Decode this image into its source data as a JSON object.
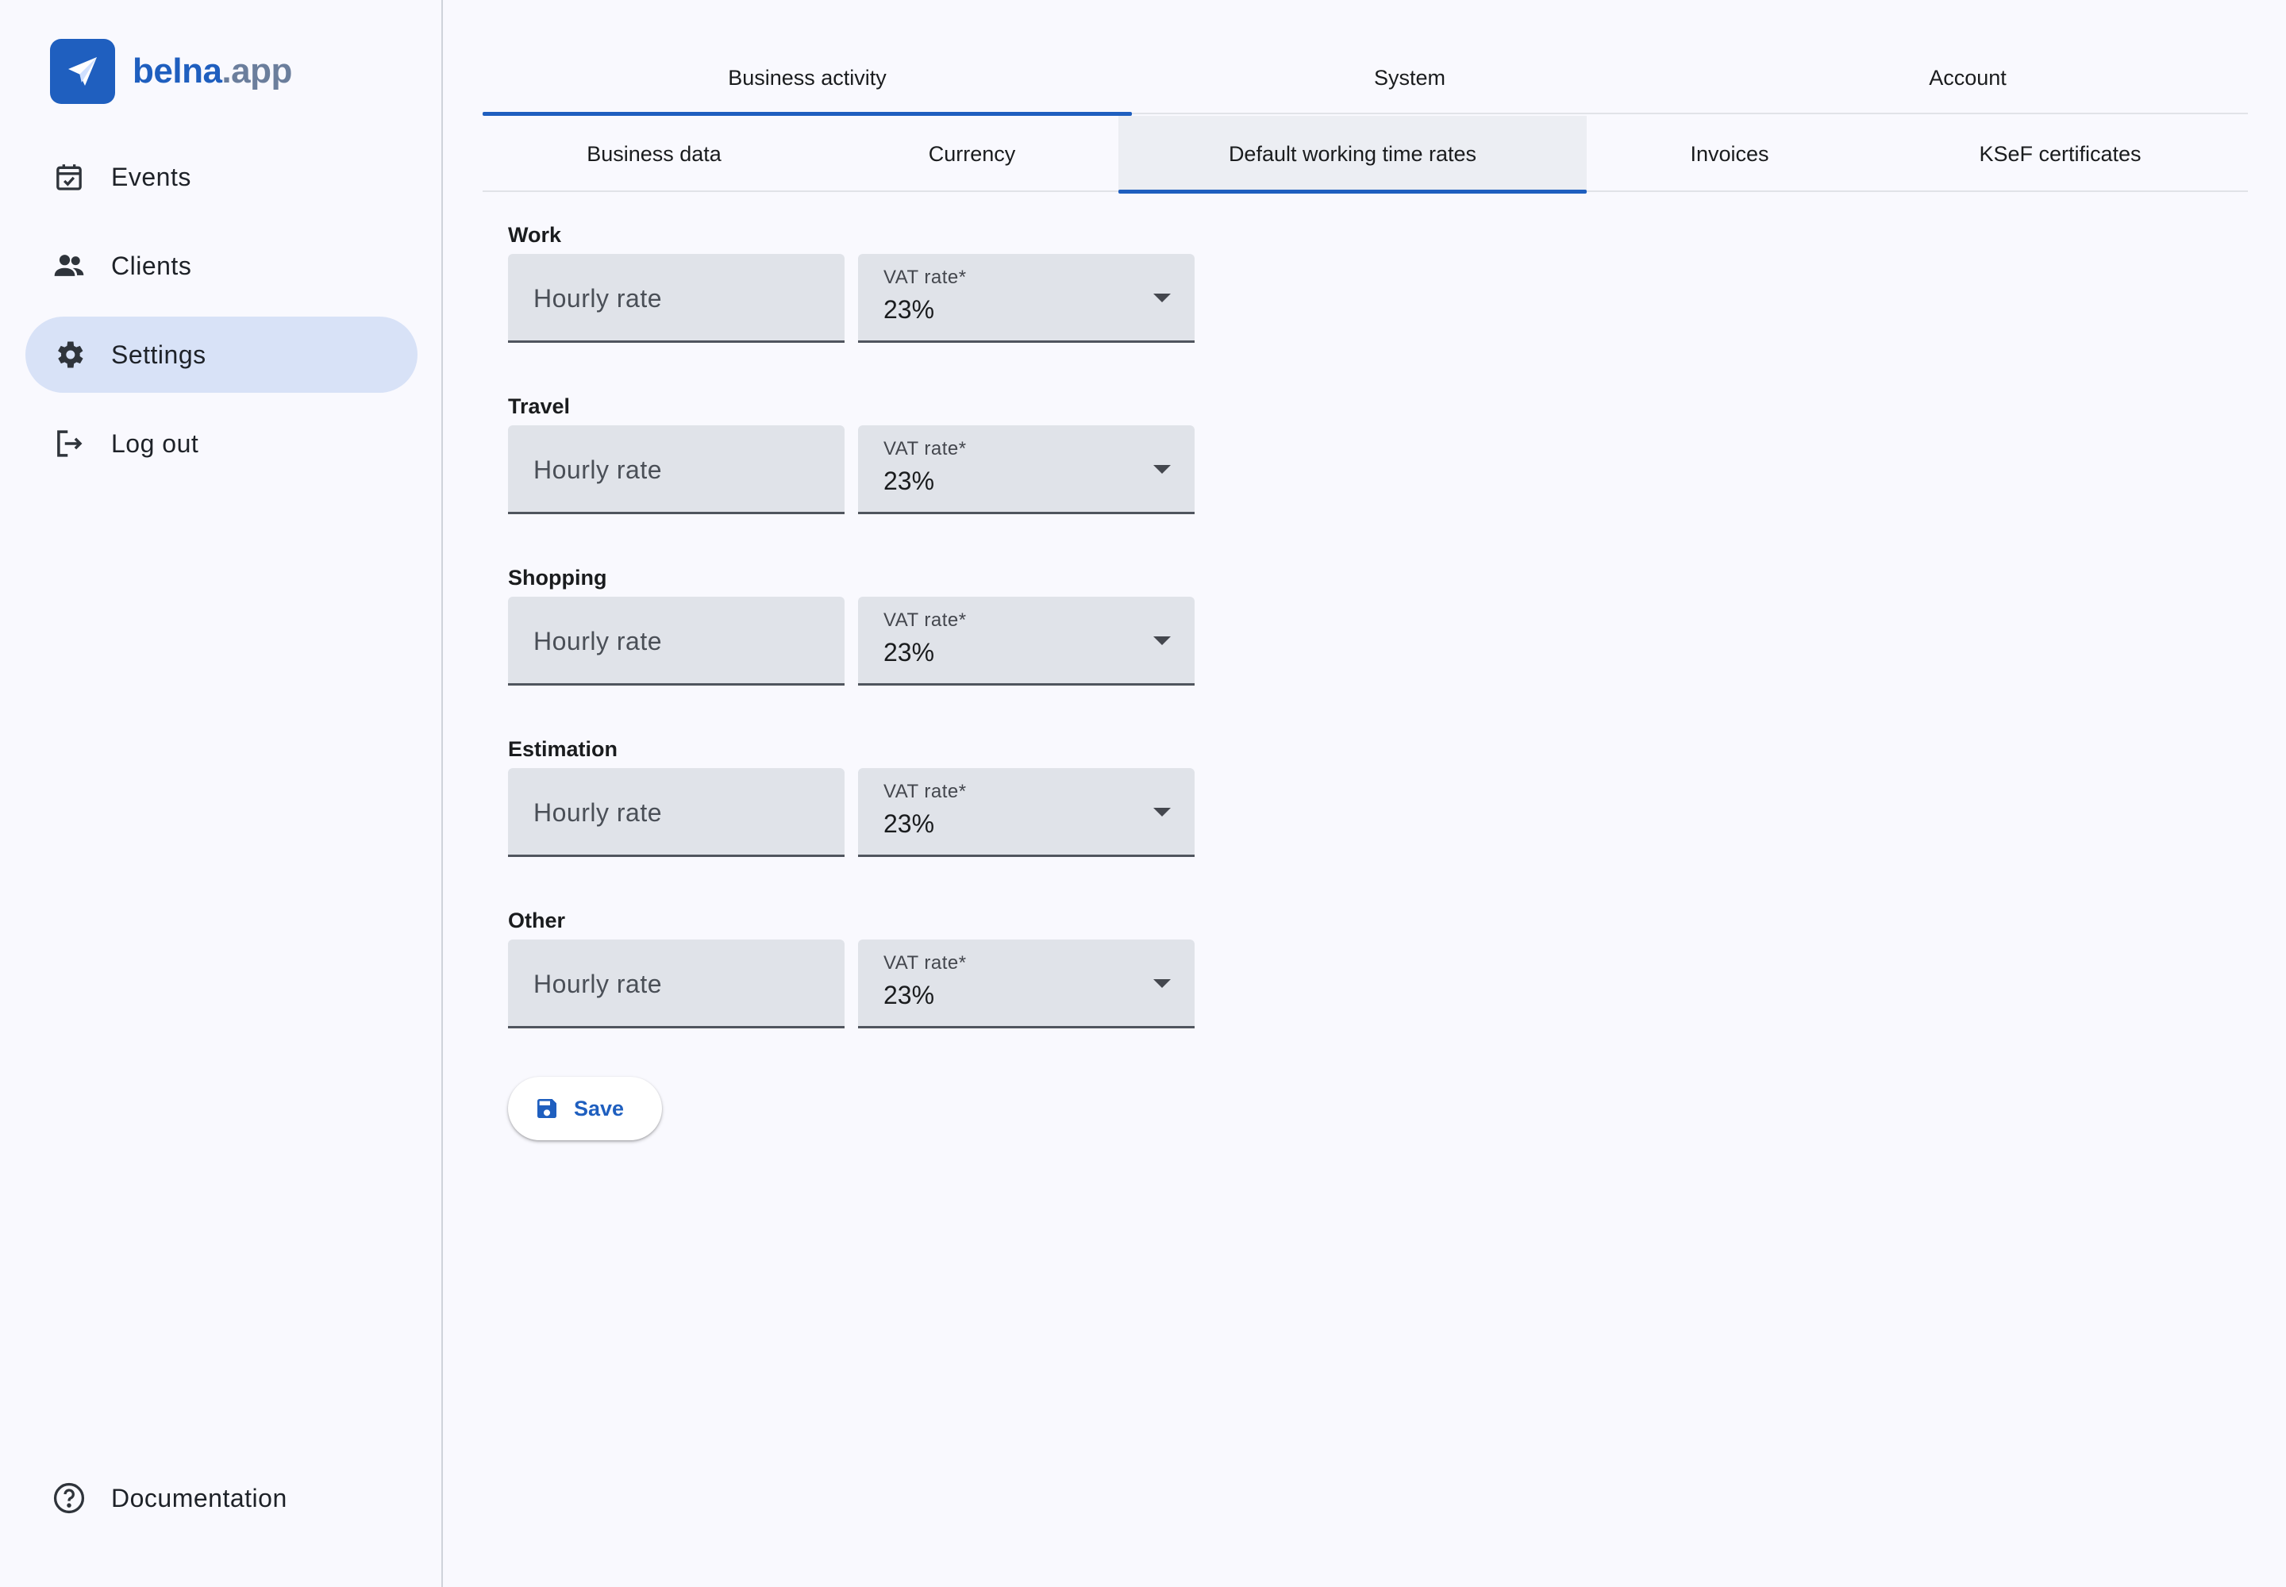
{
  "brand": {
    "name_primary": "belna",
    "name_secondary": ".app",
    "colors": {
      "primary": "#1f5fbf",
      "secondary": "#6b7e9c"
    }
  },
  "sidebar": {
    "items": [
      {
        "label": "Events",
        "icon": "calendar-check-icon"
      },
      {
        "label": "Clients",
        "icon": "people-icon"
      },
      {
        "label": "Settings",
        "icon": "gear-icon",
        "active": true
      },
      {
        "label": "Log out",
        "icon": "logout-icon"
      }
    ],
    "footer": {
      "label": "Documentation",
      "icon": "help-circle-icon"
    }
  },
  "tabs_primary": [
    {
      "label": "Business activity",
      "active": true
    },
    {
      "label": "System"
    },
    {
      "label": "Account"
    }
  ],
  "tabs_secondary": [
    {
      "label": "Business data"
    },
    {
      "label": "Currency"
    },
    {
      "label": "Default working time rates",
      "active": true
    },
    {
      "label": "Invoices"
    },
    {
      "label": "KSeF certificates"
    }
  ],
  "sections": [
    {
      "title": "Work",
      "rate_placeholder": "Hourly rate",
      "vat_label": "VAT rate*",
      "vat_value": "23%"
    },
    {
      "title": "Travel",
      "rate_placeholder": "Hourly rate",
      "vat_label": "VAT rate*",
      "vat_value": "23%"
    },
    {
      "title": "Shopping",
      "rate_placeholder": "Hourly rate",
      "vat_label": "VAT rate*",
      "vat_value": "23%"
    },
    {
      "title": "Estimation",
      "rate_placeholder": "Hourly rate",
      "vat_label": "VAT rate*",
      "vat_value": "23%"
    },
    {
      "title": "Other",
      "rate_placeholder": "Hourly rate",
      "vat_label": "VAT rate*",
      "vat_value": "23%"
    }
  ],
  "actions": {
    "save_label": "Save",
    "save_icon": "floppy-disk-icon"
  }
}
